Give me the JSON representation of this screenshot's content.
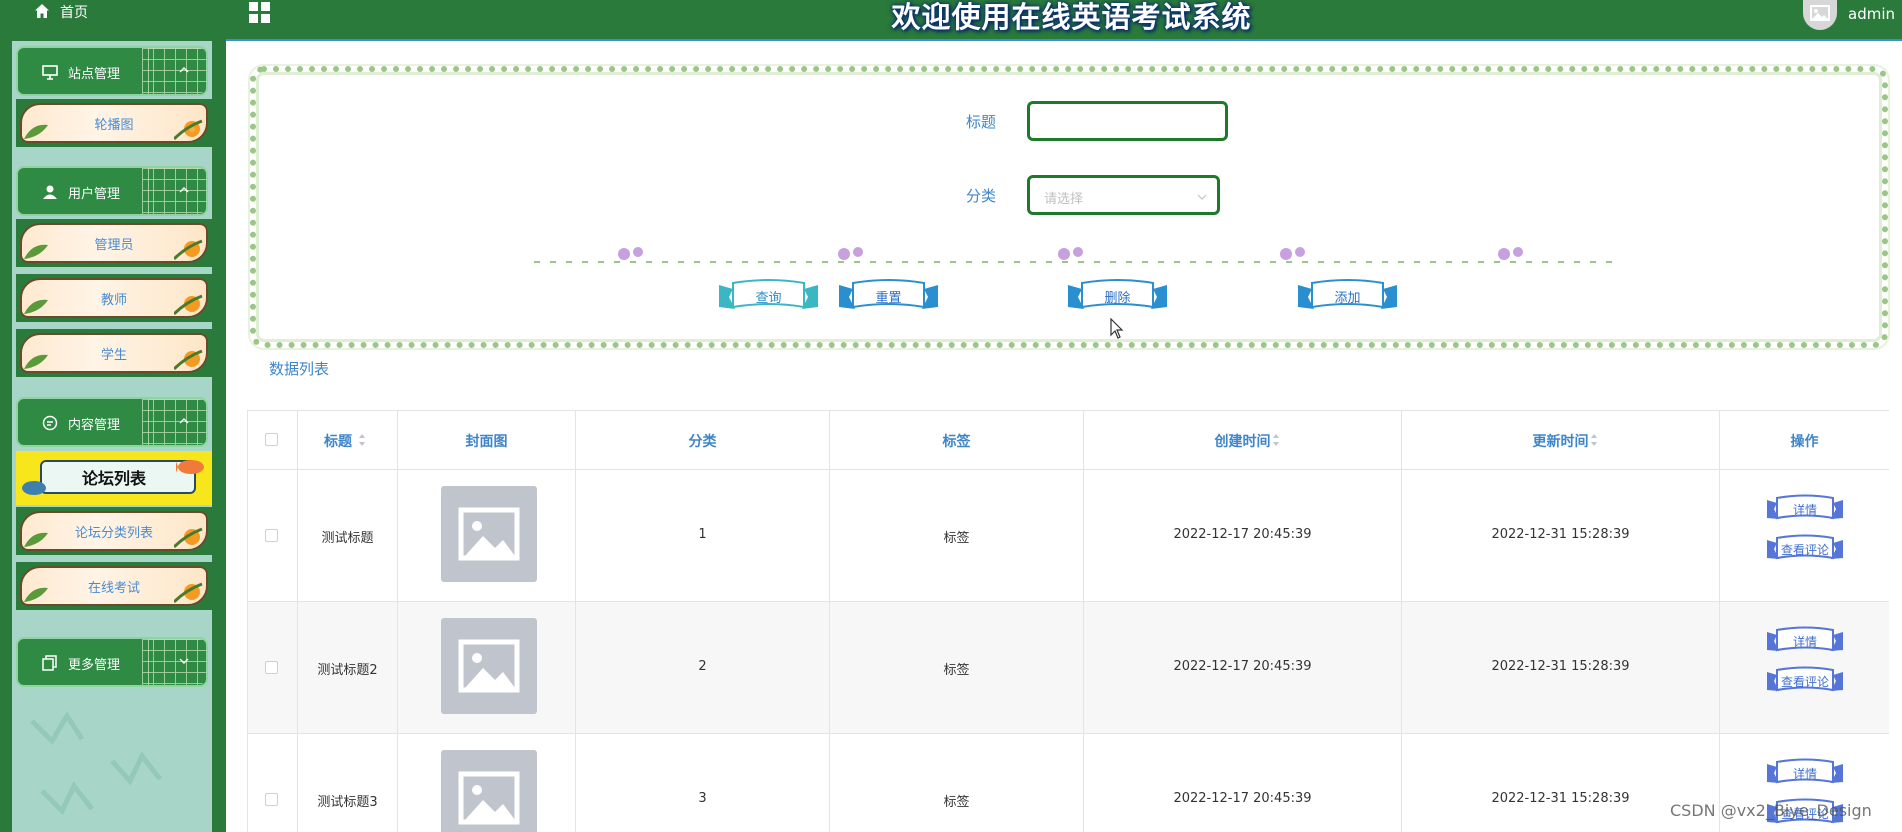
{
  "header": {
    "home_label": "首页",
    "title": "欢迎使用在线英语考试系统",
    "username": "admin",
    "colors": {
      "bar": "#2a7a3b",
      "accent": "#3b8fd4"
    }
  },
  "sidebar": {
    "groups": [
      {
        "label": "站点管理",
        "icon": "monitor-icon",
        "items": [
          {
            "label": "轮播图"
          }
        ]
      },
      {
        "label": "用户管理",
        "icon": "user-icon",
        "items": [
          {
            "label": "管理员"
          },
          {
            "label": "教师"
          },
          {
            "label": "学生"
          }
        ]
      },
      {
        "label": "内容管理",
        "icon": "message-icon",
        "items": [
          {
            "label": "论坛列表",
            "active": true
          },
          {
            "label": "论坛分类列表"
          },
          {
            "label": "在线考试"
          }
        ]
      },
      {
        "label": "更多管理",
        "icon": "copy-icon",
        "items": []
      }
    ]
  },
  "search": {
    "title_label": "标题",
    "title_value": "",
    "category_label": "分类",
    "category_placeholder": "请选择",
    "buttons": {
      "query": "查询",
      "reset": "重置",
      "delete": "删除",
      "add": "添加"
    }
  },
  "list": {
    "title": "数据列表",
    "columns": [
      "标题",
      "封面图",
      "分类",
      "标签",
      "创建时间",
      "更新时间",
      "操作"
    ],
    "rows": [
      {
        "title": "测试标题",
        "category": "1",
        "tag": "标签",
        "created": "2022-12-17 20:45:39",
        "updated": "2022-12-31 15:28:39"
      },
      {
        "title": "测试标题2",
        "category": "2",
        "tag": "标签",
        "created": "2022-12-17 20:45:39",
        "updated": "2022-12-31 15:28:39"
      },
      {
        "title": "测试标题3",
        "category": "3",
        "tag": "标签",
        "created": "2022-12-17 20:45:39",
        "updated": "2022-12-31 15:28:39"
      }
    ],
    "actions": {
      "detail": "详情",
      "comments": "查看评论"
    }
  },
  "watermark": "CSDN @vx2_Biye_Design"
}
